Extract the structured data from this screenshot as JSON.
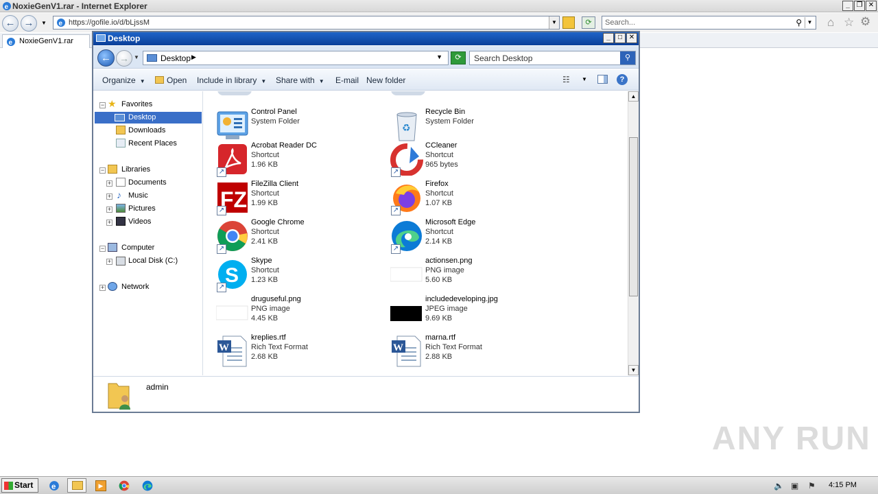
{
  "ie": {
    "title": "NoxieGenV1.rar - Internet Explorer",
    "url": "https://gofile.io/d/bLjssM",
    "search_placeholder": "Search...",
    "tab_label": "NoxieGenV1.rar"
  },
  "explorer": {
    "title": "Desktop",
    "breadcrumb": "Desktop",
    "search_placeholder": "Search Desktop",
    "commands": {
      "organize": "Organize",
      "open": "Open",
      "include": "Include in library",
      "share": "Share with",
      "email": "E-mail",
      "new_folder": "New folder"
    },
    "nav": {
      "favorites": "Favorites",
      "desktop": "Desktop",
      "downloads": "Downloads",
      "recent": "Recent Places",
      "libraries": "Libraries",
      "documents": "Documents",
      "music": "Music",
      "pictures": "Pictures",
      "videos": "Videos",
      "computer": "Computer",
      "local_disk": "Local Disk (C:)",
      "network": "Network"
    },
    "items": [
      {
        "name": "Control Panel",
        "type": "System Folder",
        "size": ""
      },
      {
        "name": "Recycle Bin",
        "type": "System Folder",
        "size": ""
      },
      {
        "name": "Acrobat Reader DC",
        "type": "Shortcut",
        "size": "1.96 KB"
      },
      {
        "name": "CCleaner",
        "type": "Shortcut",
        "size": "965 bytes"
      },
      {
        "name": "FileZilla Client",
        "type": "Shortcut",
        "size": "1.99 KB"
      },
      {
        "name": "Firefox",
        "type": "Shortcut",
        "size": "1.07 KB"
      },
      {
        "name": "Google Chrome",
        "type": "Shortcut",
        "size": "2.41 KB"
      },
      {
        "name": "Microsoft Edge",
        "type": "Shortcut",
        "size": "2.14 KB"
      },
      {
        "name": "Skype",
        "type": "Shortcut",
        "size": "1.23 KB"
      },
      {
        "name": "actionsen.png",
        "type": "PNG image",
        "size": "5.60 KB"
      },
      {
        "name": "druguseful.png",
        "type": "PNG image",
        "size": "4.45 KB"
      },
      {
        "name": "includedeveloping.jpg",
        "type": "JPEG image",
        "size": "9.69 KB"
      },
      {
        "name": "kreplies.rtf",
        "type": "Rich Text Format",
        "size": "2.68 KB"
      },
      {
        "name": "marna.rtf",
        "type": "Rich Text Format",
        "size": "2.88 KB"
      }
    ],
    "details_name": "admin"
  },
  "watermark": "ANY RUN",
  "taskbar": {
    "start": "Start",
    "clock": "4:15 PM"
  }
}
